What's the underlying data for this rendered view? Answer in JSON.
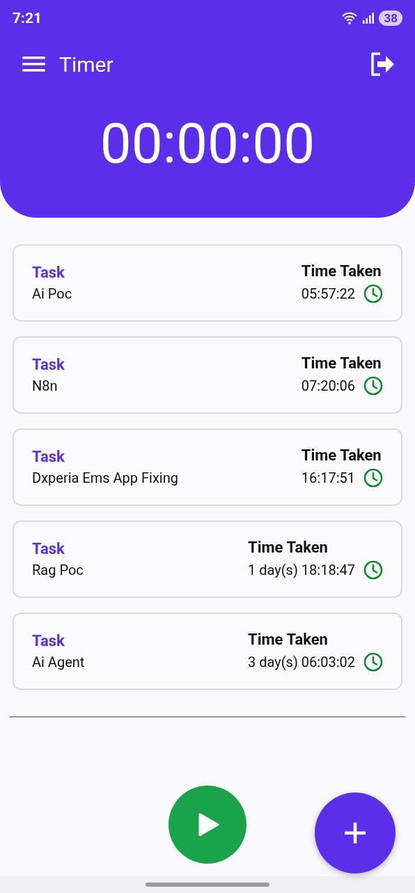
{
  "status_bar": {
    "time": "7:21",
    "battery": "38"
  },
  "app_bar": {
    "title": "Timer"
  },
  "timer": {
    "display": "00:00:00"
  },
  "tasks": [
    {
      "label": "Task",
      "name": "Ai Poc",
      "time_label": "Time Taken",
      "time_taken": "05:57:22"
    },
    {
      "label": "Task",
      "name": "N8n",
      "time_label": "Time Taken",
      "time_taken": "07:20:06"
    },
    {
      "label": "Task",
      "name": "Dxperia Ems App Fixing",
      "time_label": "Time Taken",
      "time_taken": "16:17:51"
    },
    {
      "label": "Task",
      "name": "Rag Poc",
      "time_label": "Time Taken",
      "time_taken": "1 day(s) 18:18:47"
    },
    {
      "label": "Task",
      "name": "Ai Agent",
      "time_label": "Time Taken",
      "time_taken": "3 day(s) 06:03:02"
    }
  ]
}
